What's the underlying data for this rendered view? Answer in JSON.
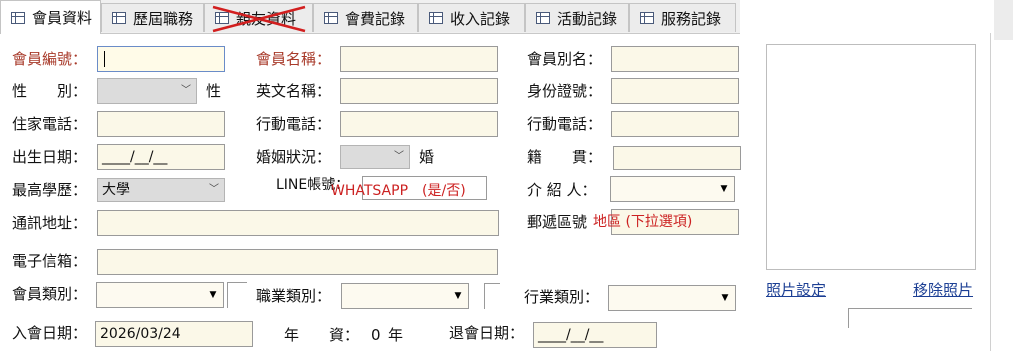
{
  "tabs": [
    {
      "label": "會員資料",
      "active": true
    },
    {
      "label": "歷屆職務",
      "active": false
    },
    {
      "label": "親友資料",
      "active": false,
      "struck": true
    },
    {
      "label": "會費記錄",
      "active": false
    },
    {
      "label": "收入記錄",
      "active": false
    },
    {
      "label": "活動記錄",
      "active": false
    },
    {
      "label": "服務記錄",
      "active": false
    }
  ],
  "form": {
    "member_no_label": "會員編號：",
    "member_name_label": "會員名稱：",
    "alias_label": "會員別名：",
    "gender_label": "性　　別：",
    "gender_suffix": "性",
    "english_name_label": "英文名稱：",
    "id_no_label": "身份證號：",
    "home_phone_label": "住家電話：",
    "mobile1_label": "行動電話：",
    "mobile2_label": "行動電話：",
    "birth_label": "出生日期：",
    "birth_value": "____/__/__",
    "marital_label": "婚姻狀況：",
    "marital_suffix": "婚",
    "native_label": "籍　　貫：",
    "education_label": "最高學歷：",
    "education_value": "大學",
    "line_label": "LINE帳號：",
    "whatsapp_hint": "WHATSAPP　(是/否)",
    "referrer_label": "介 紹 人：",
    "address_label": "通訊地址：",
    "zip_label": "郵遞區號",
    "zip_hint": "地區 (下拉選項)",
    "email_label": "電子信箱：",
    "member_type_label": "會員類別：",
    "job_type_label": "職業類別：",
    "industry_label": "行業類別：",
    "join_date_label": "入會日期：",
    "join_date_value": "2026/03/24",
    "seniority_label": "年　　資：",
    "seniority_value": "0",
    "seniority_unit": "年",
    "exit_date_label": "退會日期：",
    "exit_date_value": "____/__/__"
  },
  "photo": {
    "set_label": "照片設定",
    "remove_label": "移除照片"
  },
  "colors": {
    "field_bg": "#fbf8e8",
    "label_red": "#a83a2a",
    "hint_red": "#cc2222",
    "link_blue": "#1c3f94"
  }
}
